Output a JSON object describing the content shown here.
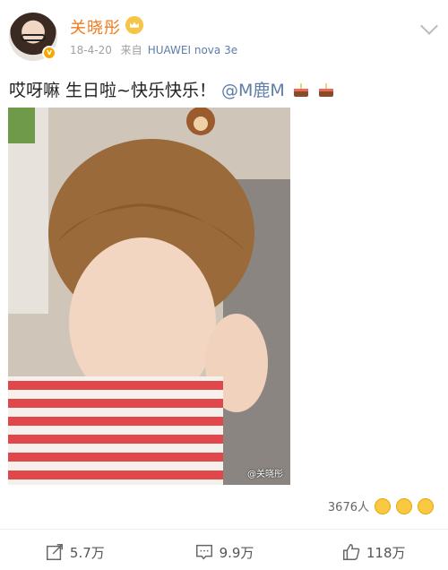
{
  "post": {
    "username": "关晓彤",
    "date": "18-4-20",
    "source_prefix": "来自",
    "source_device": "HUAWEI nova 3e",
    "text": "哎呀嘛 生日啦~快乐快乐！",
    "mention": "@M鹿M",
    "photo_watermark": "@关晓彤"
  },
  "reactions": {
    "likes_text": "3676人"
  },
  "actions": {
    "repost": "5.7万",
    "comment": "9.9万",
    "like": "118万"
  },
  "icons": [
    "vip-badge-icon",
    "crown-icon",
    "chevron-down-icon",
    "cake-icon",
    "emoji-icon",
    "repost-icon",
    "comment-icon",
    "like-icon"
  ],
  "colors": {
    "username": "#f07b1e",
    "link": "#5d7ea8",
    "meta": "#a0a0a0"
  }
}
